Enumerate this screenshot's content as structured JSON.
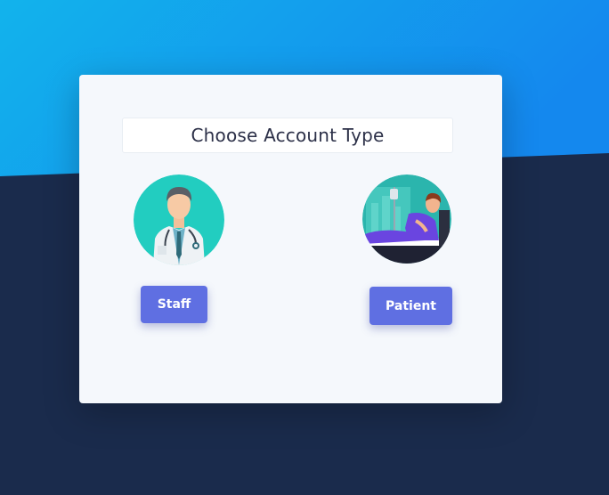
{
  "title": "Choose Account Type",
  "accounts": [
    {
      "label": "Staff",
      "icon": "doctor-icon"
    },
    {
      "label": "Patient",
      "icon": "patient-icon"
    }
  ],
  "colors": {
    "gradient_start": "#12b3ec",
    "gradient_end": "#1488ee",
    "background_dark": "#1a2b4c",
    "card": "#f5f8fc",
    "button": "#5f6fe2",
    "avatar_teal": "#22cdc0"
  }
}
